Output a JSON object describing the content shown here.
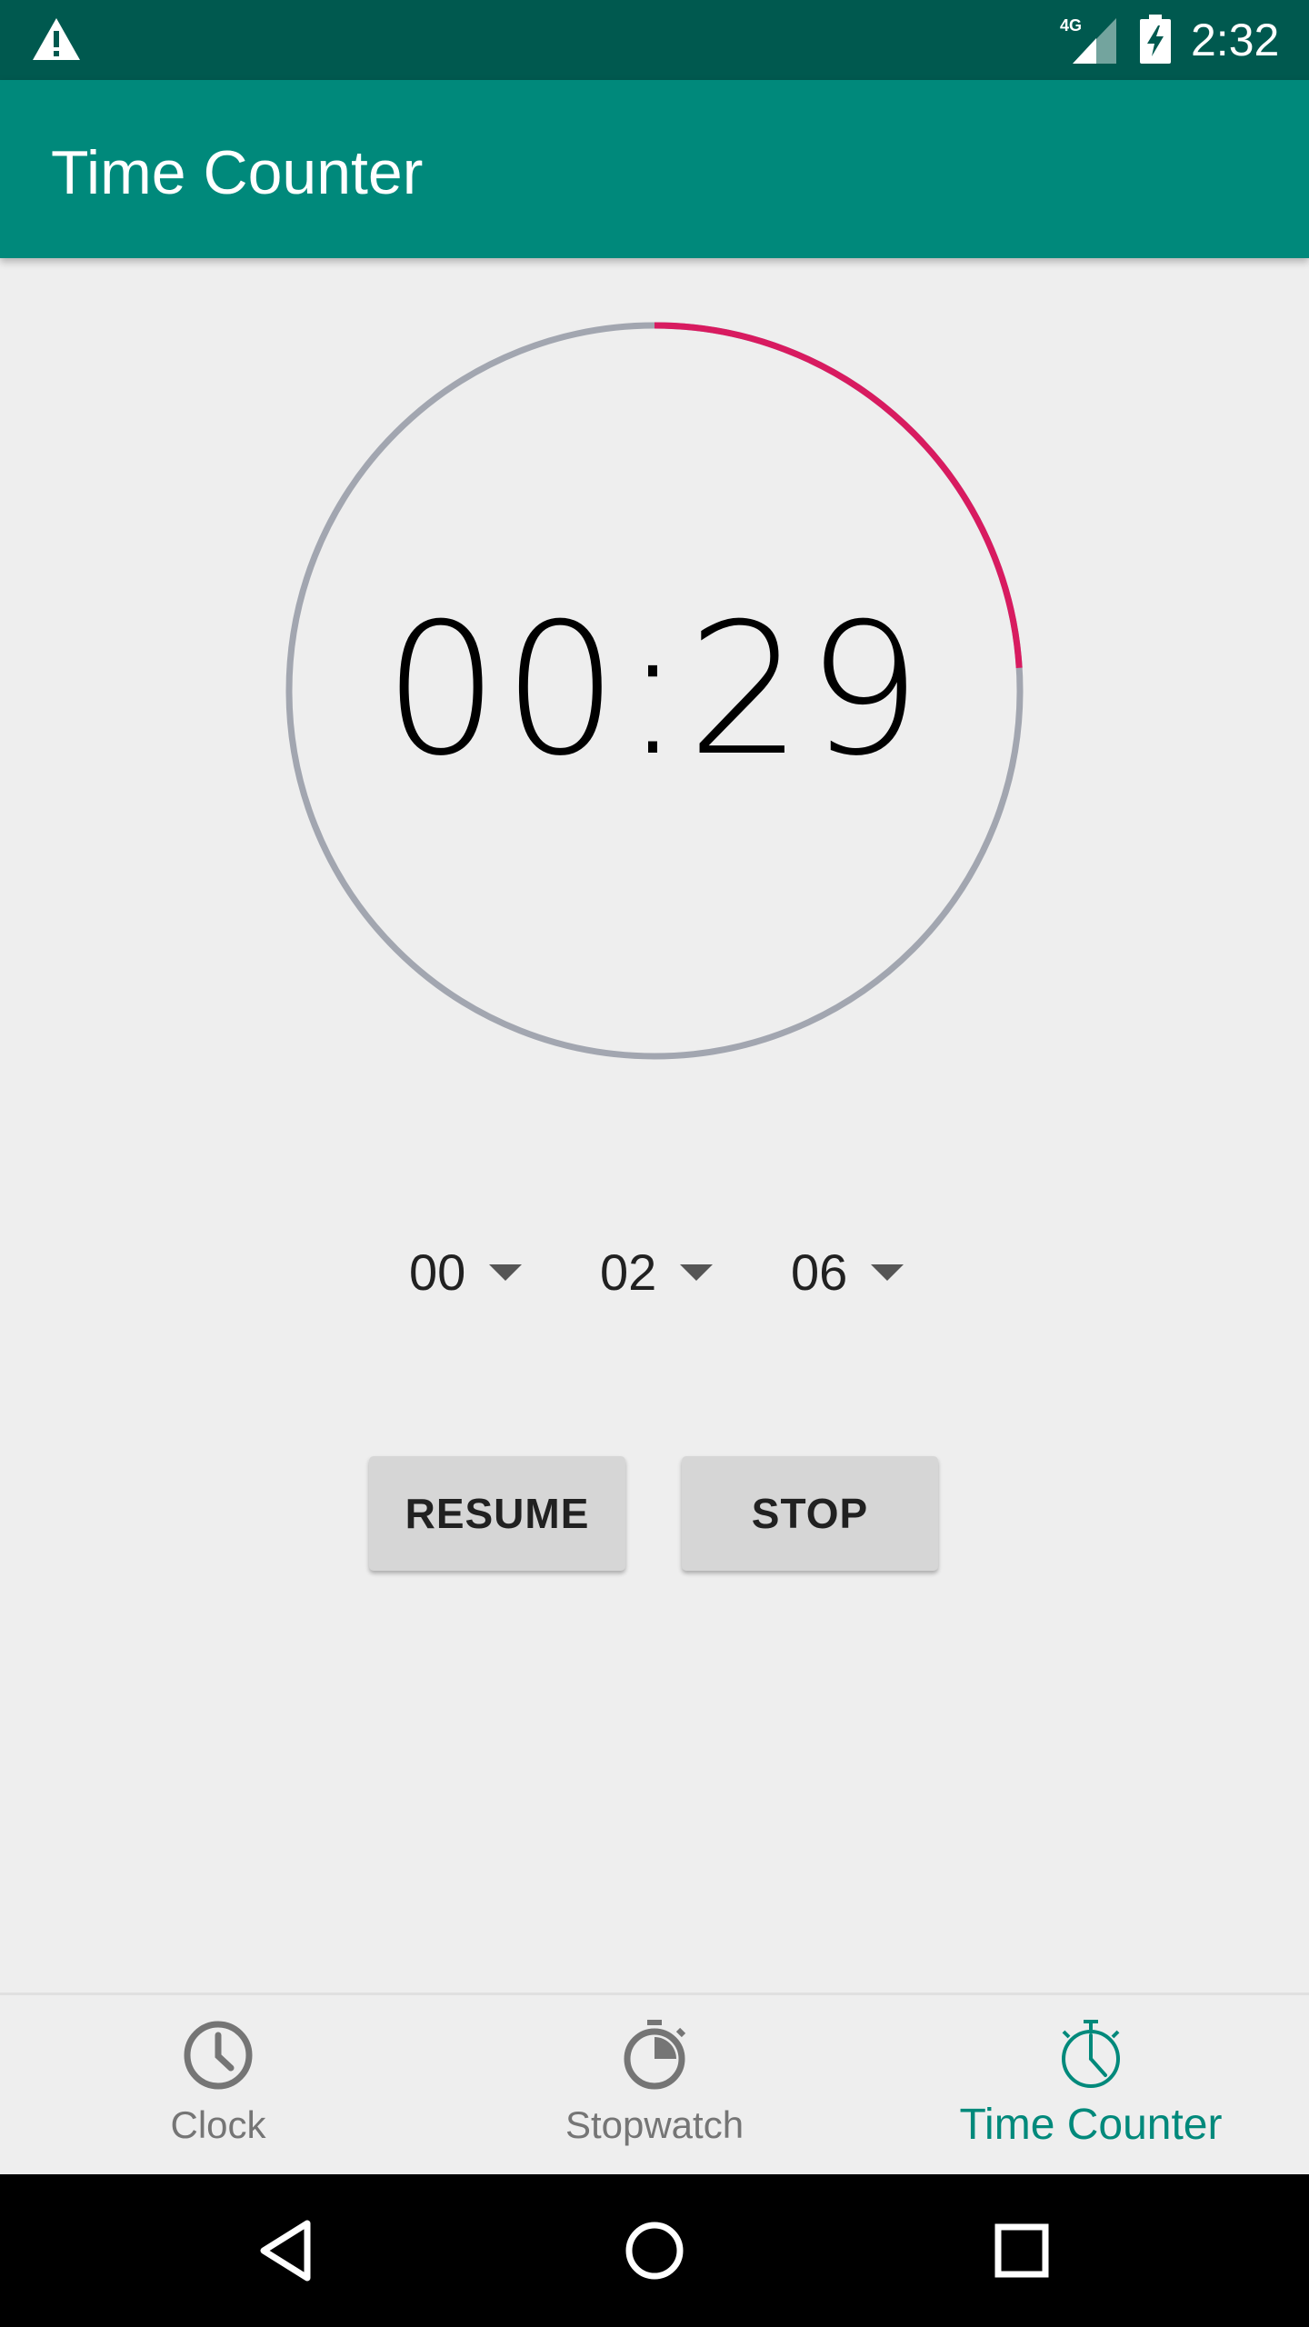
{
  "status_bar": {
    "time": "2:32",
    "network": "4G",
    "icons": [
      "warning-icon",
      "signal-icon",
      "battery-charging-icon"
    ]
  },
  "app_bar": {
    "title": "Time Counter"
  },
  "timer": {
    "display": "00:29",
    "progress_fraction": 0.24,
    "ring_color": "#a2a6b0",
    "progress_color": "#d81b60"
  },
  "spinners": {
    "hours": "00",
    "minutes": "02",
    "seconds": "06"
  },
  "buttons": {
    "resume_label": "RESUME",
    "stop_label": "STOP"
  },
  "bottom_nav": {
    "items": [
      {
        "label": "Clock",
        "icon": "clock-icon",
        "active": false
      },
      {
        "label": "Stopwatch",
        "icon": "stopwatch-icon",
        "active": false
      },
      {
        "label": "Time Counter",
        "icon": "timer-icon",
        "active": true
      }
    ],
    "active_color": "#00897b",
    "inactive_color": "#757575"
  },
  "colors": {
    "status_bar": "#00594f",
    "app_bar": "#00897b",
    "background": "#eeeeee"
  },
  "system_nav": {
    "icons": [
      "back-icon",
      "home-icon",
      "recents-icon"
    ]
  }
}
